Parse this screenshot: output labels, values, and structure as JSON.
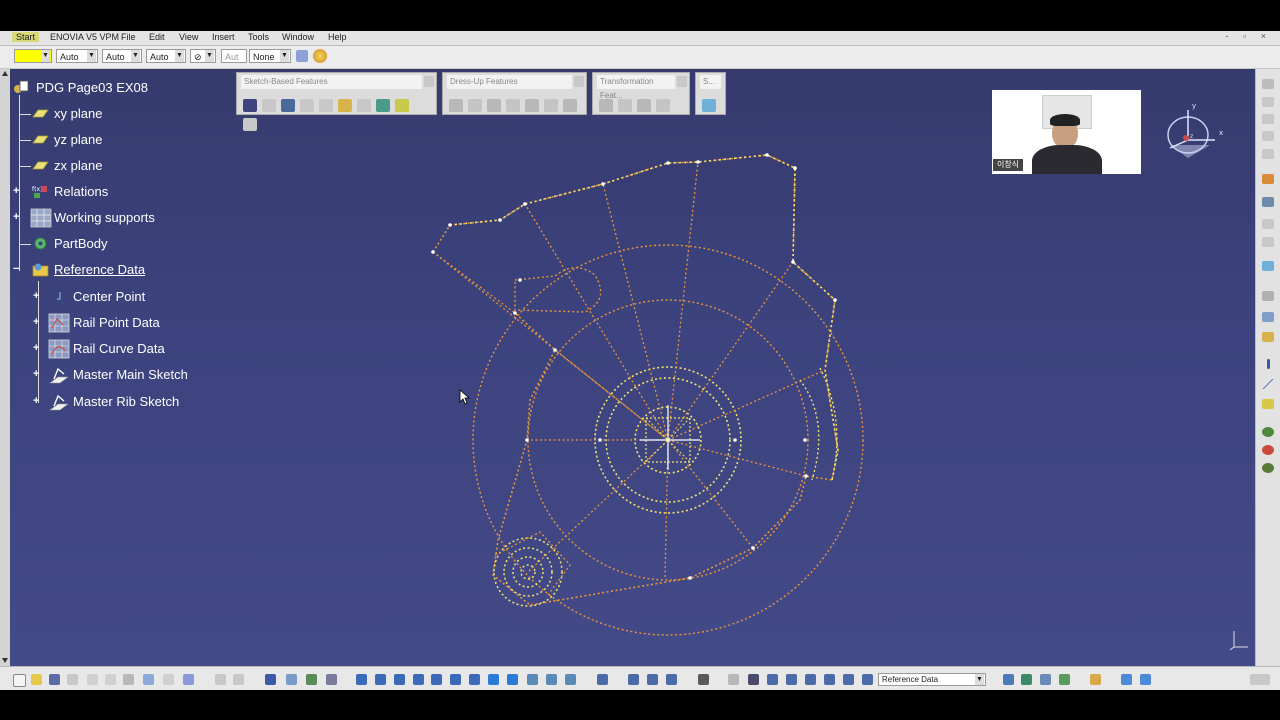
{
  "menubar": {
    "start": "Start",
    "items": [
      "ENOVIA V5 VPM",
      "File",
      "Edit",
      "View",
      "Insert",
      "Tools",
      "Window",
      "Help"
    ]
  },
  "propbar": {
    "color_combo": "",
    "combo_1": "Auto",
    "combo_2": "Auto",
    "combo_3": "Auto",
    "combo_4": "Aut",
    "combo_5": "None"
  },
  "toolbars": {
    "sketch_based": "Sketch-Based Features",
    "dress_up": "Dress-Up Features",
    "transformation": "Transformation Feat...",
    "small": "S..."
  },
  "tree": {
    "root": "PDG Page03 EX08",
    "xy": "xy plane",
    "yz": "yz plane",
    "zx": "zx plane",
    "relations": "Relations",
    "working_supports": "Working supports",
    "partbody": "PartBody",
    "reference_data": "Reference Data",
    "center_point": "Center Point",
    "rail_point_data": "Rail Point Data",
    "rail_curve_data": "Rail Curve Data",
    "master_main_sketch": "Master Main Sketch",
    "master_rib_sketch": "Master Rib Sketch"
  },
  "webcam": {
    "caption": "이창식"
  },
  "compass": {
    "x": "x",
    "y": "y",
    "z": "z"
  },
  "bottombar": {
    "current_body": "Reference Data"
  },
  "colors": {
    "viewport": "#3c437e",
    "sketch_orange": "#e8953a",
    "sketch_yellow": "#f2e46a",
    "tree_text": "#ffffff"
  }
}
